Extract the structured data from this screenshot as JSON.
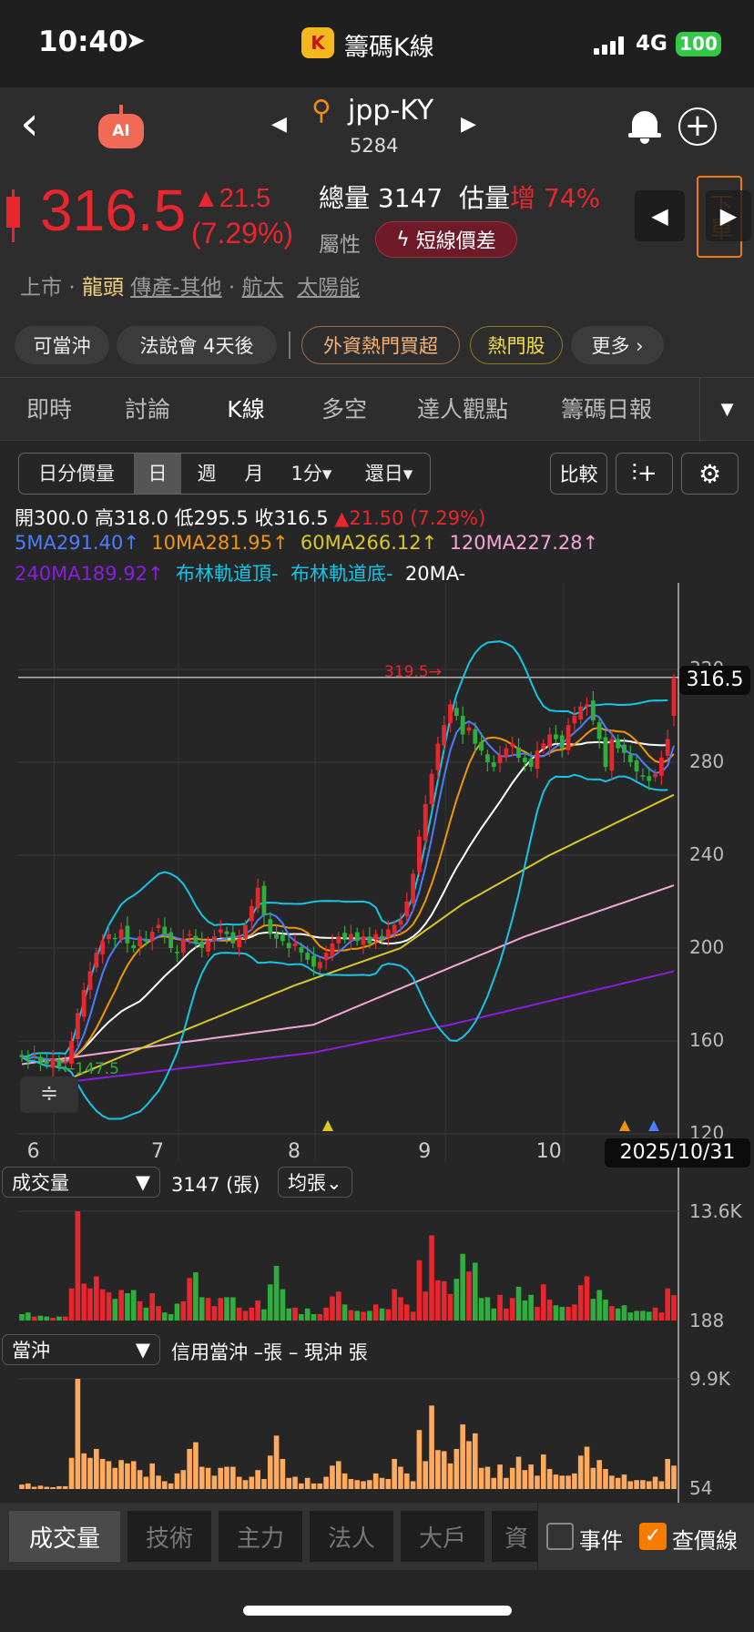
{
  "status": {
    "time": "10:40",
    "app_title": "籌碼K線",
    "network": "4G",
    "battery": "100"
  },
  "header": {
    "symbol": "jpp-KY",
    "code": "5284",
    "ai_label": "AI"
  },
  "quote": {
    "price": "316.5",
    "change": "▲21.5",
    "change_pct": "(7.29%)",
    "volume_label": "總量",
    "volume": "3147",
    "est_label": "估量",
    "est_dir": "增",
    "est_pct": "74%",
    "attr_label": "屬性",
    "attr_badge": "短線價差",
    "order_label": "下單"
  },
  "tags": {
    "market": "上市",
    "sep1": "·",
    "leader": "龍頭",
    "industry": "傳產-其他",
    "sep2": "·",
    "t1": "航太",
    "t2": "太陽能"
  },
  "chips": [
    "可當沖",
    "法說會 4天後",
    "外資熱門買超",
    "熱門股",
    "更多 ›"
  ],
  "tabs": [
    "即時",
    "討論",
    "K線",
    "多空",
    "達人觀點",
    "籌碼日報"
  ],
  "toolbar": {
    "segments": [
      "日分價量",
      "日",
      "週",
      "月",
      "1分▾",
      "還日▾"
    ],
    "compare": "比較"
  },
  "ohlc": {
    "open_l": "開",
    "open": "300.0",
    "high_l": "高",
    "high": "318.0",
    "low_l": "低",
    "low": "295.5",
    "close_l": "收",
    "close": "316.5",
    "chg": "▲21.50 (7.29%)"
  },
  "ma_legend": [
    {
      "text": "5MA291.40↑",
      "color": "#4a7dff"
    },
    {
      "text": "10MA281.95↑",
      "color": "#f0960a"
    },
    {
      "text": "60MA266.12↑",
      "color": "#d8c828"
    },
    {
      "text": "120MA227.28↑",
      "color": "#f4a6d8"
    },
    {
      "text": "240MA189.92↑",
      "color": "#8a1ee0"
    },
    {
      "text": "布林軌道頂-",
      "color": "#18c4e6"
    },
    {
      "text": "布林軌道底-",
      "color": "#18c4e6"
    },
    {
      "text": "20MA-",
      "color": "#ffffff"
    }
  ],
  "chart_data": {
    "type": "candlestick",
    "y_ticks": [
      "320",
      "280",
      "240",
      "200",
      "160",
      "120"
    ],
    "y_tick_values": [
      320,
      280,
      240,
      200,
      160,
      120
    ],
    "x_ticks": [
      "6",
      "7",
      "8",
      "9",
      "10"
    ],
    "x_tick_days": [
      3,
      23,
      45,
      66,
      85
    ],
    "last_price_label": "316.5",
    "date_label": "2025/10/31",
    "high_annot": "319.5→",
    "low_annot": "←147.5",
    "closes": [
      153,
      152,
      154,
      151,
      150,
      152,
      149,
      151,
      160,
      172,
      182,
      190,
      198,
      203,
      206,
      204,
      208,
      202,
      200,
      205,
      203,
      207,
      210,
      206,
      200,
      198,
      204,
      206,
      202,
      200,
      203,
      205,
      208,
      206,
      202,
      204,
      210,
      218,
      226,
      214,
      206,
      204,
      203,
      200,
      202,
      198,
      195,
      192,
      194,
      198,
      202,
      205,
      204,
      206,
      203,
      205,
      202,
      206,
      204,
      208,
      210,
      212,
      220,
      232,
      248,
      262,
      275,
      288,
      296,
      305,
      300,
      292,
      295,
      288,
      285,
      280,
      278,
      283,
      286,
      288,
      282,
      280,
      278,
      285,
      288,
      292,
      290,
      286,
      296,
      300,
      304,
      305,
      298,
      290,
      278,
      290,
      286,
      284,
      280,
      276,
      274,
      272,
      275,
      282,
      290,
      316.5
    ],
    "last_ohlc": [
      300,
      318,
      295.5,
      316.5
    ],
    "ma60": [
      [
        8,
        143
      ],
      [
        23,
        160
      ],
      [
        45,
        184
      ],
      [
        62,
        200
      ],
      [
        72,
        219
      ],
      [
        86,
        240
      ],
      [
        106,
        266
      ]
    ],
    "ma120": [
      [
        1,
        150
      ],
      [
        23,
        158
      ],
      [
        48,
        167
      ],
      [
        65,
        186
      ],
      [
        82,
        205
      ],
      [
        106,
        227
      ]
    ],
    "ma240": [
      [
        1,
        140
      ],
      [
        48,
        155
      ],
      [
        70,
        167
      ],
      [
        106,
        190
      ]
    ],
    "colors": {
      "up": "#e8262e",
      "down": "#2fae3e",
      "ma5": "#4a7dff",
      "ma10": "#f0960a",
      "ma20": "#ffffff",
      "ma60": "#d8c828",
      "ma120": "#f4a6d8",
      "ma240": "#8a1ee0",
      "boll": "#18c4e6",
      "daytrade": "#ffaa5c"
    }
  },
  "volume": {
    "selector": "成交量",
    "value": "3147 (張)",
    "mode": "均張⌄",
    "max_label": "13.6K",
    "min_label": "188",
    "max": 13600,
    "values": [
      800,
      1000,
      500,
      600,
      500,
      300,
      500,
      500,
      4000,
      13600,
      4600,
      4000,
      5500,
      3900,
      3500,
      2700,
      3800,
      3400,
      3800,
      2400,
      1600,
      3400,
      1800,
      1000,
      800,
      2100,
      2400,
      5300,
      6000,
      2900,
      2800,
      1800,
      2800,
      2900,
      2900,
      1600,
      1200,
      1600,
      2500,
      1400,
      4500,
      6800,
      3900,
      1500,
      1600,
      800,
      1500,
      800,
      800,
      1600,
      3000,
      3600,
      2000,
      1300,
      1200,
      1100,
      1200,
      2000,
      1500,
      1400,
      3900,
      2900,
      2000,
      1100,
      7500,
      3600,
      10600,
      5000,
      4900,
      3300,
      5200,
      8300,
      6100,
      7200,
      2800,
      2900,
      1500,
      3200,
      1500,
      2800,
      4200,
      2500,
      3200,
      1700,
      4500,
      2600,
      1900,
      1700,
      1700,
      2000,
      4400,
      5500,
      2700,
      3800,
      2600,
      1800,
      1500,
      1900,
      1000,
      1200,
      1200,
      1100,
      1600,
      1000,
      4000,
      3147
    ]
  },
  "daytrade": {
    "selector": "當沖",
    "text": "信用當沖 –張 – 現沖 張",
    "max_label": "9.9K",
    "min_label": "54",
    "max": 9900,
    "values": [
      400,
      500,
      200,
      300,
      200,
      150,
      250,
      250,
      2800,
      9900,
      3200,
      2800,
      3600,
      2700,
      2500,
      1900,
      2600,
      2300,
      2500,
      1700,
      1100,
      2300,
      1200,
      700,
      500,
      1400,
      1700,
      3600,
      4200,
      2000,
      1900,
      1200,
      1900,
      2000,
      2000,
      1100,
      800,
      1100,
      1700,
      900,
      3000,
      4800,
      2700,
      1000,
      1100,
      500,
      1000,
      500,
      500,
      1100,
      2100,
      2500,
      1400,
      900,
      800,
      700,
      800,
      1400,
      1000,
      900,
      2700,
      2000,
      1400,
      700,
      5300,
      2500,
      7500,
      3500,
      3400,
      2300,
      3600,
      5800,
      4300,
      5000,
      1900,
      2000,
      1000,
      2200,
      1000,
      1900,
      2900,
      1700,
      2200,
      1200,
      3100,
      1800,
      1300,
      1200,
      1200,
      1400,
      3000,
      3800,
      1900,
      2600,
      1800,
      1200,
      1000,
      1300,
      700,
      800,
      800,
      700,
      1100,
      700,
      2700,
      2100
    ]
  },
  "bottom_tabs": [
    "成交量",
    "技術",
    "主力",
    "法人",
    "大戶",
    "資"
  ],
  "options": {
    "event": "事件",
    "price_line": "查價線"
  }
}
